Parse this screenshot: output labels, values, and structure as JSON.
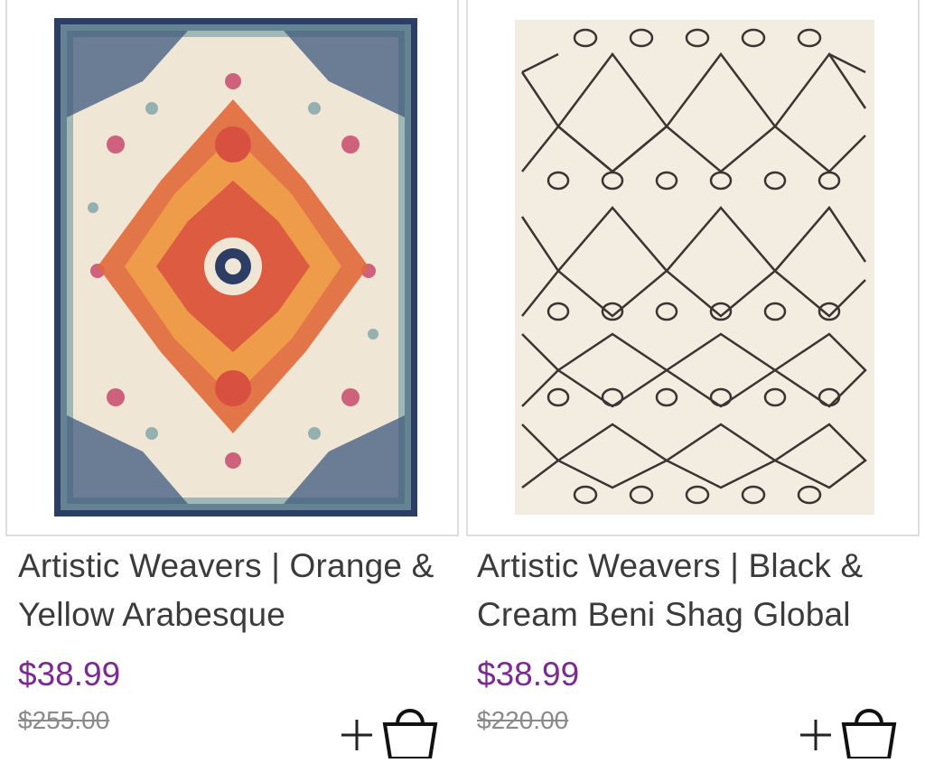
{
  "products": [
    {
      "title": "Artistic Weavers | Orange & Yellow Arabesque",
      "price": "$38.99",
      "was_price": "$255.00",
      "image_icon": "rug-medallion-image",
      "colors": {
        "navy": "#2c3e64",
        "orange": "#e1693a",
        "cream": "#efe6d6",
        "teal": "#7ea3a6",
        "pink": "#c84a6d"
      }
    },
    {
      "title": "Artistic Weavers | Black & Cream Beni Shag Global",
      "price": "$38.99",
      "was_price": "$220.00",
      "image_icon": "rug-diamond-lattice-image",
      "colors": {
        "cream": "#f3ece0",
        "ink": "#3a3532"
      }
    }
  ],
  "accent_price_color": "#7b2a91",
  "add_to_cart_icon": "plus-bag-icon"
}
